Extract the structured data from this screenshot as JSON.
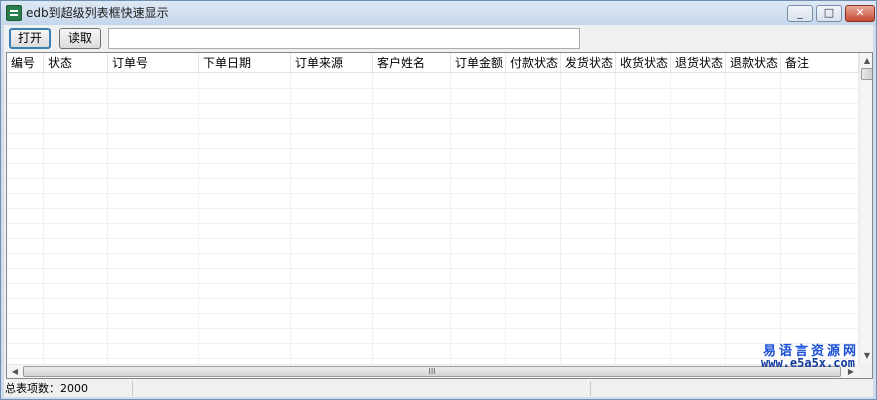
{
  "window": {
    "title": "edb到超级列表框快速显示",
    "minimize_label": "_",
    "maximize_label": "□",
    "close_label": "✕"
  },
  "toolbar": {
    "open_label": "打开",
    "read_label": "读取",
    "path_value": ""
  },
  "table": {
    "columns": [
      "编号",
      "状态",
      "订单号",
      "下单日期",
      "订单来源",
      "客户姓名",
      "订单金额",
      "付款状态",
      "发货状态",
      "收货状态",
      "退货状态",
      "退款状态",
      "备注"
    ],
    "rows": []
  },
  "scroll": {
    "up_arrow": "▲",
    "down_arrow": "▼",
    "left_arrow": "◀",
    "right_arrow": "▶",
    "grip": "III"
  },
  "status": {
    "total_items": "总表项数：2000"
  },
  "watermark": {
    "site_name": "易语言资源网",
    "url": "www.e5a5x.com"
  }
}
